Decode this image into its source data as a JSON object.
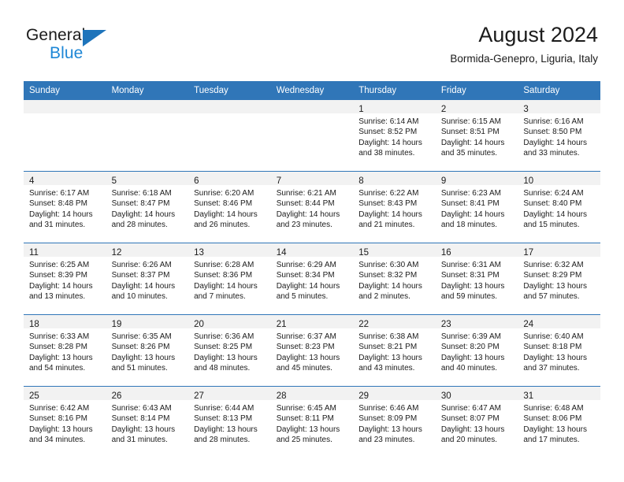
{
  "logo": {
    "word_top": "General",
    "word_bottom": "Blue",
    "triangle_color": "#1e74bb",
    "bottom_color": "#1e87d6"
  },
  "header": {
    "title": "August 2024",
    "subtitle": "Bormida-Genepro, Liguria, Italy"
  },
  "theme": {
    "header_row_bg": "#3076b8",
    "daynum_band_bg": "#f2f2f2",
    "text_color": "#1b1b1b",
    "page_bg": "#ffffff"
  },
  "weekday_headers": [
    "Sunday",
    "Monday",
    "Tuesday",
    "Wednesday",
    "Thursday",
    "Friday",
    "Saturday"
  ],
  "labels": {
    "sunrise_prefix": "Sunrise:",
    "sunset_prefix": "Sunset:",
    "daylight_prefix": "Daylight:"
  },
  "weeks": [
    [
      {
        "day": "",
        "line1": "",
        "line2": "",
        "line3": "",
        "line4": ""
      },
      {
        "day": "",
        "line1": "",
        "line2": "",
        "line3": "",
        "line4": ""
      },
      {
        "day": "",
        "line1": "",
        "line2": "",
        "line3": "",
        "line4": ""
      },
      {
        "day": "",
        "line1": "",
        "line2": "",
        "line3": "",
        "line4": ""
      },
      {
        "day": "1",
        "line1": "Sunrise: 6:14 AM",
        "line2": "Sunset: 8:52 PM",
        "line3": "Daylight: 14 hours",
        "line4": "and 38 minutes."
      },
      {
        "day": "2",
        "line1": "Sunrise: 6:15 AM",
        "line2": "Sunset: 8:51 PM",
        "line3": "Daylight: 14 hours",
        "line4": "and 35 minutes."
      },
      {
        "day": "3",
        "line1": "Sunrise: 6:16 AM",
        "line2": "Sunset: 8:50 PM",
        "line3": "Daylight: 14 hours",
        "line4": "and 33 minutes."
      }
    ],
    [
      {
        "day": "4",
        "line1": "Sunrise: 6:17 AM",
        "line2": "Sunset: 8:48 PM",
        "line3": "Daylight: 14 hours",
        "line4": "and 31 minutes."
      },
      {
        "day": "5",
        "line1": "Sunrise: 6:18 AM",
        "line2": "Sunset: 8:47 PM",
        "line3": "Daylight: 14 hours",
        "line4": "and 28 minutes."
      },
      {
        "day": "6",
        "line1": "Sunrise: 6:20 AM",
        "line2": "Sunset: 8:46 PM",
        "line3": "Daylight: 14 hours",
        "line4": "and 26 minutes."
      },
      {
        "day": "7",
        "line1": "Sunrise: 6:21 AM",
        "line2": "Sunset: 8:44 PM",
        "line3": "Daylight: 14 hours",
        "line4": "and 23 minutes."
      },
      {
        "day": "8",
        "line1": "Sunrise: 6:22 AM",
        "line2": "Sunset: 8:43 PM",
        "line3": "Daylight: 14 hours",
        "line4": "and 21 minutes."
      },
      {
        "day": "9",
        "line1": "Sunrise: 6:23 AM",
        "line2": "Sunset: 8:41 PM",
        "line3": "Daylight: 14 hours",
        "line4": "and 18 minutes."
      },
      {
        "day": "10",
        "line1": "Sunrise: 6:24 AM",
        "line2": "Sunset: 8:40 PM",
        "line3": "Daylight: 14 hours",
        "line4": "and 15 minutes."
      }
    ],
    [
      {
        "day": "11",
        "line1": "Sunrise: 6:25 AM",
        "line2": "Sunset: 8:39 PM",
        "line3": "Daylight: 14 hours",
        "line4": "and 13 minutes."
      },
      {
        "day": "12",
        "line1": "Sunrise: 6:26 AM",
        "line2": "Sunset: 8:37 PM",
        "line3": "Daylight: 14 hours",
        "line4": "and 10 minutes."
      },
      {
        "day": "13",
        "line1": "Sunrise: 6:28 AM",
        "line2": "Sunset: 8:36 PM",
        "line3": "Daylight: 14 hours",
        "line4": "and 7 minutes."
      },
      {
        "day": "14",
        "line1": "Sunrise: 6:29 AM",
        "line2": "Sunset: 8:34 PM",
        "line3": "Daylight: 14 hours",
        "line4": "and 5 minutes."
      },
      {
        "day": "15",
        "line1": "Sunrise: 6:30 AM",
        "line2": "Sunset: 8:32 PM",
        "line3": "Daylight: 14 hours",
        "line4": "and 2 minutes."
      },
      {
        "day": "16",
        "line1": "Sunrise: 6:31 AM",
        "line2": "Sunset: 8:31 PM",
        "line3": "Daylight: 13 hours",
        "line4": "and 59 minutes."
      },
      {
        "day": "17",
        "line1": "Sunrise: 6:32 AM",
        "line2": "Sunset: 8:29 PM",
        "line3": "Daylight: 13 hours",
        "line4": "and 57 minutes."
      }
    ],
    [
      {
        "day": "18",
        "line1": "Sunrise: 6:33 AM",
        "line2": "Sunset: 8:28 PM",
        "line3": "Daylight: 13 hours",
        "line4": "and 54 minutes."
      },
      {
        "day": "19",
        "line1": "Sunrise: 6:35 AM",
        "line2": "Sunset: 8:26 PM",
        "line3": "Daylight: 13 hours",
        "line4": "and 51 minutes."
      },
      {
        "day": "20",
        "line1": "Sunrise: 6:36 AM",
        "line2": "Sunset: 8:25 PM",
        "line3": "Daylight: 13 hours",
        "line4": "and 48 minutes."
      },
      {
        "day": "21",
        "line1": "Sunrise: 6:37 AM",
        "line2": "Sunset: 8:23 PM",
        "line3": "Daylight: 13 hours",
        "line4": "and 45 minutes."
      },
      {
        "day": "22",
        "line1": "Sunrise: 6:38 AM",
        "line2": "Sunset: 8:21 PM",
        "line3": "Daylight: 13 hours",
        "line4": "and 43 minutes."
      },
      {
        "day": "23",
        "line1": "Sunrise: 6:39 AM",
        "line2": "Sunset: 8:20 PM",
        "line3": "Daylight: 13 hours",
        "line4": "and 40 minutes."
      },
      {
        "day": "24",
        "line1": "Sunrise: 6:40 AM",
        "line2": "Sunset: 8:18 PM",
        "line3": "Daylight: 13 hours",
        "line4": "and 37 minutes."
      }
    ],
    [
      {
        "day": "25",
        "line1": "Sunrise: 6:42 AM",
        "line2": "Sunset: 8:16 PM",
        "line3": "Daylight: 13 hours",
        "line4": "and 34 minutes."
      },
      {
        "day": "26",
        "line1": "Sunrise: 6:43 AM",
        "line2": "Sunset: 8:14 PM",
        "line3": "Daylight: 13 hours",
        "line4": "and 31 minutes."
      },
      {
        "day": "27",
        "line1": "Sunrise: 6:44 AM",
        "line2": "Sunset: 8:13 PM",
        "line3": "Daylight: 13 hours",
        "line4": "and 28 minutes."
      },
      {
        "day": "28",
        "line1": "Sunrise: 6:45 AM",
        "line2": "Sunset: 8:11 PM",
        "line3": "Daylight: 13 hours",
        "line4": "and 25 minutes."
      },
      {
        "day": "29",
        "line1": "Sunrise: 6:46 AM",
        "line2": "Sunset: 8:09 PM",
        "line3": "Daylight: 13 hours",
        "line4": "and 23 minutes."
      },
      {
        "day": "30",
        "line1": "Sunrise: 6:47 AM",
        "line2": "Sunset: 8:07 PM",
        "line3": "Daylight: 13 hours",
        "line4": "and 20 minutes."
      },
      {
        "day": "31",
        "line1": "Sunrise: 6:48 AM",
        "line2": "Sunset: 8:06 PM",
        "line3": "Daylight: 13 hours",
        "line4": "and 17 minutes."
      }
    ]
  ]
}
